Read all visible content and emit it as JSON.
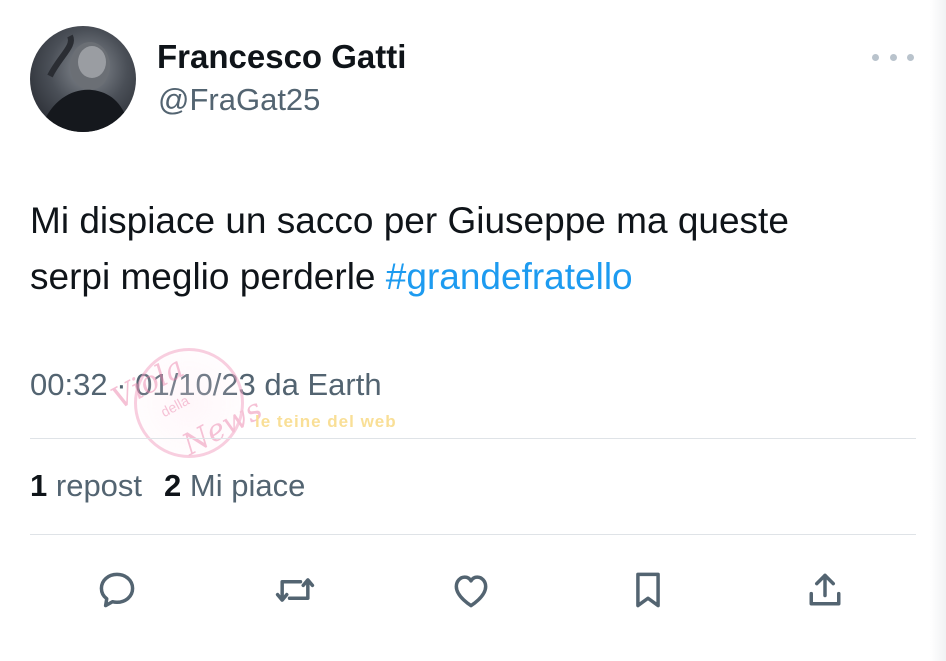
{
  "author": {
    "display_name": "Francesco Gatti",
    "handle": "@FraGat25",
    "avatar_icon": "user-avatar"
  },
  "more_icon": "ellipsis-icon",
  "tweet": {
    "text_line1": "Mi dispiace un sacco per Giuseppe ma queste",
    "text_line2_prefix": "serpi meglio perderle ",
    "hashtag": "#grandefratello",
    "meta": "00:32 · 01/10/23 da Earth"
  },
  "stats": {
    "reposts_count": "1",
    "reposts_label": "repost",
    "likes_count": "2",
    "likes_label": "Mi piace"
  },
  "actions": [
    {
      "icon": "reply-icon"
    },
    {
      "icon": "repost-icon"
    },
    {
      "icon": "like-icon"
    },
    {
      "icon": "bookmark-icon"
    },
    {
      "icon": "share-icon"
    }
  ],
  "watermark": {
    "script_line1": "Viola",
    "script_small": "della",
    "script_line2": "News",
    "brand": "le teine del web"
  },
  "colors": {
    "text": "#0f1419",
    "secondary": "#536471",
    "link": "#1d9bf0",
    "divider": "#dfe3e7"
  }
}
